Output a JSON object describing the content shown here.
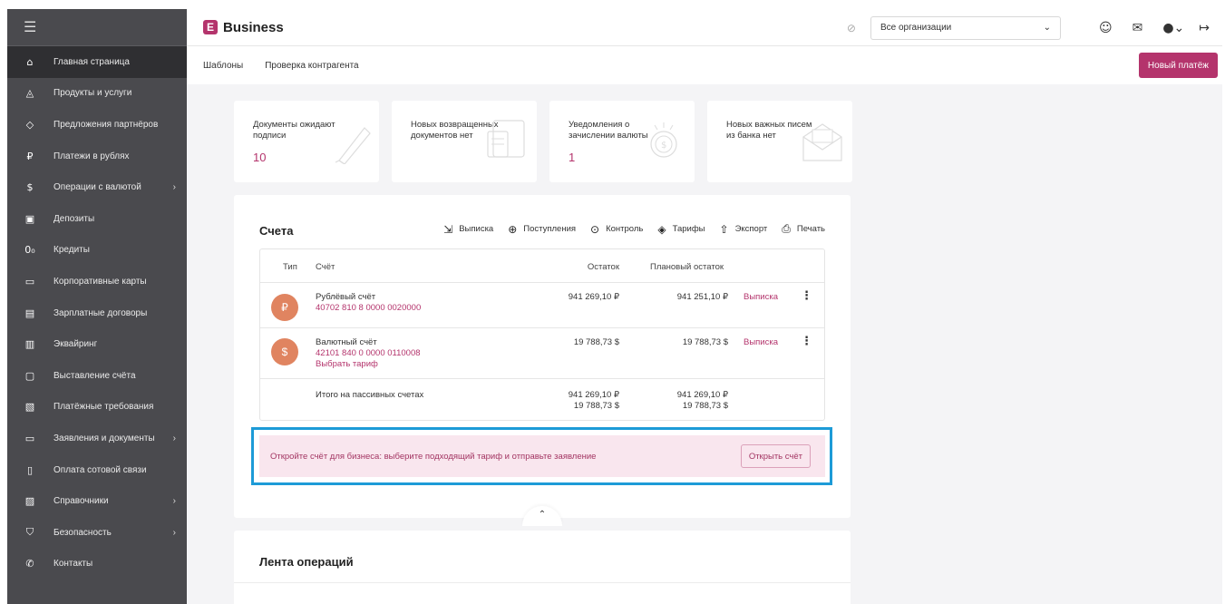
{
  "colors": {
    "brand": "#b4346c",
    "sidebar": "#4a4a4e",
    "badge": "#e08460",
    "highlight_outline": "#1d9bd7",
    "banner_bg": "#f9e6ee"
  },
  "sidebar": {
    "items": [
      {
        "label": "Главная страница",
        "icon": "home-icon",
        "glyph": "⌂",
        "active": true
      },
      {
        "label": "Продукты и услуги",
        "icon": "bag-icon",
        "glyph": "◬"
      },
      {
        "label": "Предложения партнёров",
        "icon": "tag-icon",
        "glyph": "◇"
      },
      {
        "label": "Платежи в рублях",
        "icon": "ruble-icon",
        "glyph": "₽"
      },
      {
        "label": "Операции с валютой",
        "icon": "dollar-icon",
        "glyph": "$",
        "chevron": "›"
      },
      {
        "label": "Депозиты",
        "icon": "deposit-icon",
        "glyph": "▣"
      },
      {
        "label": "Кредиты",
        "icon": "credit-icon",
        "glyph": "0₀"
      },
      {
        "label": "Корпоративные карты",
        "icon": "card-icon",
        "glyph": "▭"
      },
      {
        "label": "Зарплатные договоры",
        "icon": "payroll-icon",
        "glyph": "▤"
      },
      {
        "label": "Эквайринг",
        "icon": "terminal-icon",
        "glyph": "▥"
      },
      {
        "label": "Выставление счёта",
        "icon": "invoice-icon",
        "glyph": "▢"
      },
      {
        "label": "Платёжные требования",
        "icon": "request-icon",
        "glyph": "▧"
      },
      {
        "label": "Заявления и документы",
        "icon": "folder-icon",
        "glyph": "▭",
        "chevron": "›"
      },
      {
        "label": "Оплата сотовой связи",
        "icon": "phone-icon",
        "glyph": "▯"
      },
      {
        "label": "Справочники",
        "icon": "book-icon",
        "glyph": "▨",
        "chevron": "›"
      },
      {
        "label": "Безопасность",
        "icon": "shield-icon",
        "glyph": "⛉",
        "chevron": "›"
      },
      {
        "label": "Контакты",
        "icon": "contact-phone-icon",
        "glyph": "✆"
      }
    ]
  },
  "header": {
    "brand_letter": "E",
    "brand": "Business",
    "org_select": "Все организации",
    "org_select_caret": "⌄"
  },
  "subnav": {
    "templates": "Шаблоны",
    "counterparty": "Проверка контрагента",
    "new_payment": "Новый платёж"
  },
  "cards": [
    {
      "text": "Документы ожидают подписи",
      "value": "10",
      "icon": "pen-icon"
    },
    {
      "text": "Новых возвращенных документов нет",
      "value": "",
      "icon": "documents-icon"
    },
    {
      "text": "Уведомления о зачислении валюты",
      "value": "1",
      "icon": "coin-icon"
    },
    {
      "text": "Новых важных писем из банка нет",
      "value": "",
      "icon": "envelope-icon"
    }
  ],
  "accounts": {
    "title": "Счета",
    "toolbar": {
      "statement": "Выписка",
      "receipts": "Поступления",
      "control": "Контроль",
      "tariffs": "Тарифы",
      "export": "Экспорт",
      "print": "Печать"
    },
    "columns": {
      "type": "Тип",
      "account": "Счёт",
      "balance": "Остаток",
      "planned": "Плановый остаток"
    },
    "rows": [
      {
        "badge": "₽",
        "name": "Рублёвый счёт",
        "number": "40702 810 8 0000 0020000",
        "extra": "",
        "balance": "941 269,10 ₽",
        "planned": "941 251,10 ₽",
        "action": "Выписка"
      },
      {
        "badge": "$",
        "name": "Валютный счёт",
        "number": "42101 840 0 0000 0110008",
        "extra": "Выбрать тариф",
        "balance": "19 788,73 $",
        "planned": "19 788,73 $",
        "action": "Выписка"
      }
    ],
    "total": {
      "label": "Итого на пассивных счетах",
      "balance_rub": "941 269,10 ₽",
      "balance_usd": "19 788,73 $",
      "planned_rub": "941 269,10 ₽",
      "planned_usd": "19 788,73 $"
    },
    "banner": {
      "text": "Откройте счёт для бизнеса: выберите подходящий тариф и отправьте заявление",
      "button": "Открыть счёт"
    },
    "collapse": "⌃"
  },
  "feed": {
    "title": "Лента операций"
  }
}
